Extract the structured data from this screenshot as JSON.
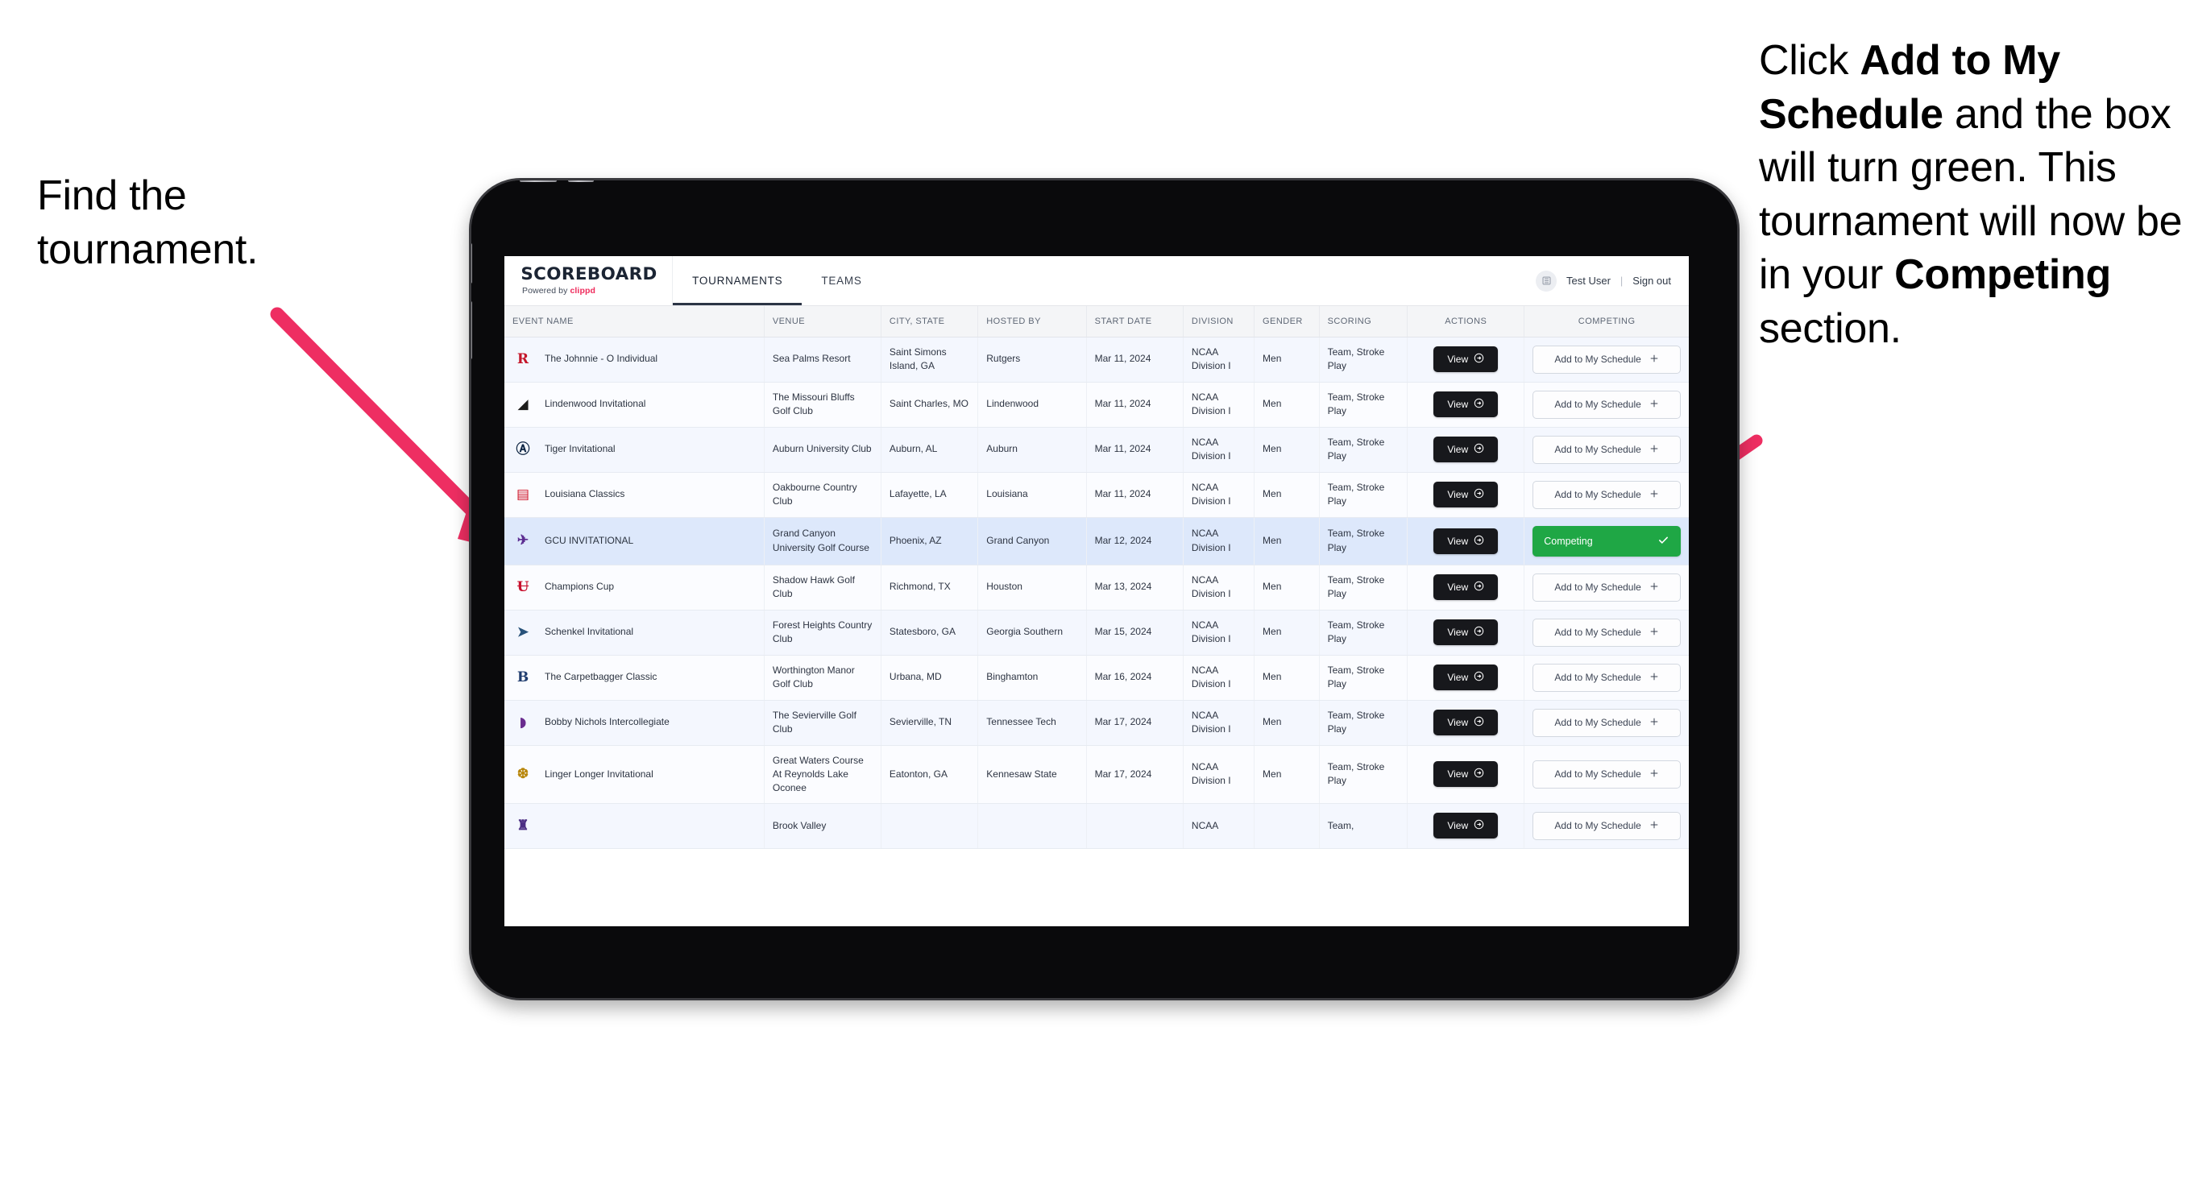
{
  "annotations": {
    "left": "Find the tournament.",
    "right_parts": [
      {
        "t": "Click ",
        "b": false
      },
      {
        "t": "Add to My Schedule",
        "b": true
      },
      {
        "t": " and the box will turn green. This tournament will now be in your ",
        "b": false
      },
      {
        "t": "Competing",
        "b": true
      },
      {
        "t": " section.",
        "b": false
      }
    ],
    "arrow_color": "#ee2e62"
  },
  "app": {
    "brand": {
      "title": "SCOREBOARD",
      "powered_prefix": "Powered by ",
      "powered_brand": "clippd"
    },
    "tabs": [
      {
        "label": "TOURNAMENTS",
        "active": true
      },
      {
        "label": "TEAMS",
        "active": false
      }
    ],
    "user": {
      "avatar_icon": "user-avatar-icon",
      "name": "Test User",
      "separator": "|",
      "signout": "Sign out"
    },
    "table": {
      "columns": [
        "EVENT NAME",
        "VENUE",
        "CITY, STATE",
        "HOSTED BY",
        "START DATE",
        "DIVISION",
        "GENDER",
        "SCORING",
        "ACTIONS",
        "COMPETING"
      ],
      "action_view_label": "View",
      "action_add_label": "Add to My Schedule",
      "action_competing_label": "Competing",
      "rows": [
        {
          "logo_text": "R",
          "logo_color": "#c4162a",
          "event": "The Johnnie - O Individual",
          "venue": "Sea Palms Resort",
          "city": "Saint Simons Island, GA",
          "host": "Rutgers",
          "date": "Mar 11, 2024",
          "division": "NCAA Division I",
          "gender": "Men",
          "scoring": "Team, Stroke Play",
          "competing": false
        },
        {
          "logo_text": "◢",
          "logo_color": "#1d1d1b",
          "event": "Lindenwood Invitational",
          "venue": "The Missouri Bluffs Golf Club",
          "city": "Saint Charles, MO",
          "host": "Lindenwood",
          "date": "Mar 11, 2024",
          "division": "NCAA Division I",
          "gender": "Men",
          "scoring": "Team, Stroke Play",
          "competing": false
        },
        {
          "logo_text": "Ⓐ",
          "logo_color": "#0c2340",
          "event": "Tiger Invitational",
          "venue": "Auburn University Club",
          "city": "Auburn, AL",
          "host": "Auburn",
          "date": "Mar 11, 2024",
          "division": "NCAA Division I",
          "gender": "Men",
          "scoring": "Team, Stroke Play",
          "competing": false
        },
        {
          "logo_text": "▤",
          "logo_color": "#ce1126",
          "event": "Louisiana Classics",
          "venue": "Oakbourne Country Club",
          "city": "Lafayette, LA",
          "host": "Louisiana",
          "date": "Mar 11, 2024",
          "division": "NCAA Division I",
          "gender": "Men",
          "scoring": "Team, Stroke Play",
          "competing": false
        },
        {
          "logo_text": "✈",
          "logo_color": "#5c2d91",
          "event": "GCU INVITATIONAL",
          "venue": "Grand Canyon University Golf Course",
          "city": "Phoenix, AZ",
          "host": "Grand Canyon",
          "date": "Mar 12, 2024",
          "division": "NCAA Division I",
          "gender": "Men",
          "scoring": "Team, Stroke Play",
          "competing": true
        },
        {
          "logo_text": "Ʉ",
          "logo_color": "#c8102e",
          "event": "Champions Cup",
          "venue": "Shadow Hawk Golf Club",
          "city": "Richmond, TX",
          "host": "Houston",
          "date": "Mar 13, 2024",
          "division": "NCAA Division I",
          "gender": "Men",
          "scoring": "Team, Stroke Play",
          "competing": false
        },
        {
          "logo_text": "➤",
          "logo_color": "#28527a",
          "event": "Schenkel Invitational",
          "venue": "Forest Heights Country Club",
          "city": "Statesboro, GA",
          "host": "Georgia Southern",
          "date": "Mar 15, 2024",
          "division": "NCAA Division I",
          "gender": "Men",
          "scoring": "Team, Stroke Play",
          "competing": false
        },
        {
          "logo_text": "B",
          "logo_color": "#1f3c6e",
          "event": "The Carpetbagger Classic",
          "venue": "Worthington Manor Golf Club",
          "city": "Urbana, MD",
          "host": "Binghamton",
          "date": "Mar 16, 2024",
          "division": "NCAA Division I",
          "gender": "Men",
          "scoring": "Team, Stroke Play",
          "competing": false
        },
        {
          "logo_text": "◗",
          "logo_color": "#6a2c8f",
          "event": "Bobby Nichols Intercollegiate",
          "venue": "The Sevierville Golf Club",
          "city": "Sevierville, TN",
          "host": "Tennessee Tech",
          "date": "Mar 17, 2024",
          "division": "NCAA Division I",
          "gender": "Men",
          "scoring": "Team, Stroke Play",
          "competing": false
        },
        {
          "logo_text": "❆",
          "logo_color": "#b8860b",
          "event": "Linger Longer Invitational",
          "venue": "Great Waters Course At Reynolds Lake Oconee",
          "city": "Eatonton, GA",
          "host": "Kennesaw State",
          "date": "Mar 17, 2024",
          "division": "NCAA Division I",
          "gender": "Men",
          "scoring": "Team, Stroke Play",
          "competing": false
        },
        {
          "logo_text": "♜",
          "logo_color": "#4b2e83",
          "event": "",
          "venue": "Brook Valley",
          "city": "",
          "host": "",
          "date": "",
          "division": "NCAA",
          "gender": "",
          "scoring": "Team,",
          "competing": false
        }
      ]
    }
  }
}
